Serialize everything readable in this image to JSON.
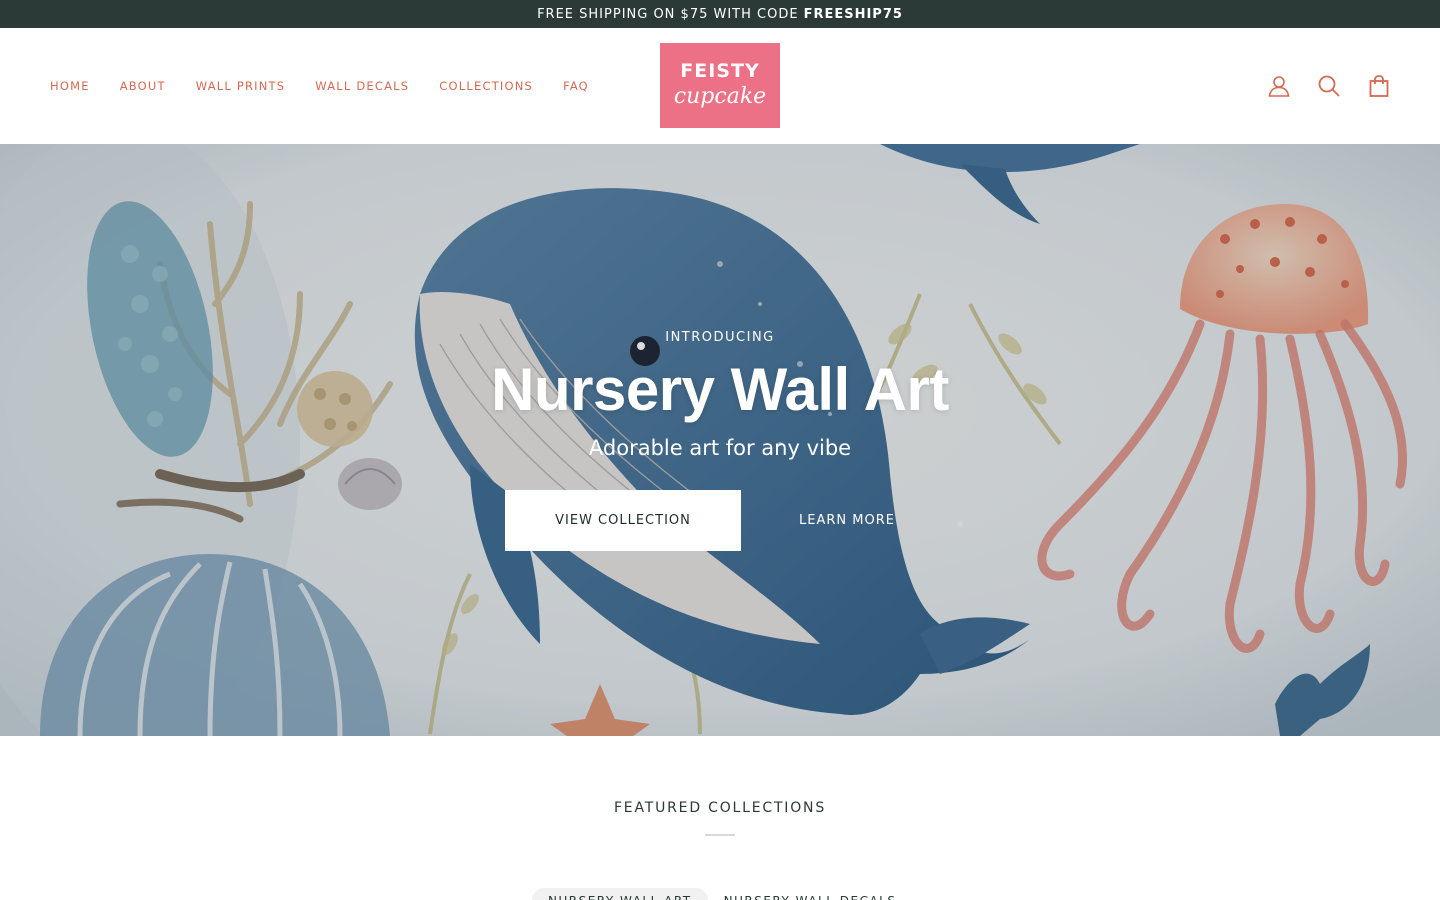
{
  "announcement": {
    "text": "FREE SHIPPING ON $75 WITH CODE",
    "code": "FREESHIP75"
  },
  "nav": {
    "items": [
      {
        "label": "HOME"
      },
      {
        "label": "ABOUT"
      },
      {
        "label": "WALL PRINTS"
      },
      {
        "label": "WALL DECALS"
      },
      {
        "label": "COLLECTIONS"
      },
      {
        "label": "FAQ"
      }
    ]
  },
  "logo": {
    "line1": "FEISTY",
    "line2": "cupcake"
  },
  "header_icons": [
    "user-icon",
    "search-icon",
    "cart-icon"
  ],
  "colors": {
    "announcement_bg": "#2b3a36",
    "nav_text": "#d46a52",
    "logo_bg": "#ec7186"
  },
  "hero": {
    "kicker": "INTRODUCING",
    "title": "Nursery Wall Art",
    "subtitle": "Adorable art for any vibe",
    "primary_button": "VIEW COLLECTION",
    "secondary_button": "LEARN MORE"
  },
  "featured": {
    "heading": "FEATURED COLLECTIONS",
    "tabs": [
      {
        "label": "NURSERY WALL ART",
        "active": true
      },
      {
        "label": "NURSERY WALL DECALS",
        "active": false
      }
    ]
  }
}
